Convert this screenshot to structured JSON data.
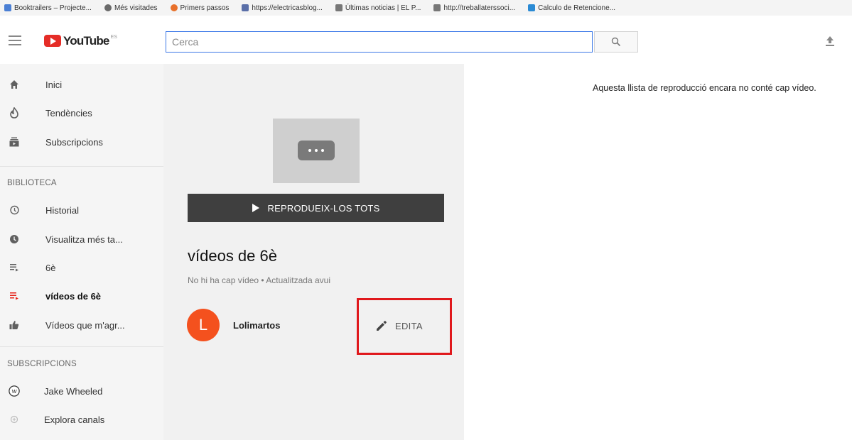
{
  "bookmarks": [
    {
      "label": "Booktrailers – Projecte...",
      "color": "#4a7fd4"
    },
    {
      "label": "Més visitades",
      "color": "#6a6a6a"
    },
    {
      "label": "Primers passos",
      "color": "#e8702a"
    },
    {
      "label": "https://electricasblog...",
      "color": "#5a6fa8"
    },
    {
      "label": "Últimas noticias | EL P...",
      "color": "#777777"
    },
    {
      "label": "http://treballaterssoci...",
      "color": "#777777"
    },
    {
      "label": "Calculo de Retencione...",
      "color": "#2a8ad4"
    }
  ],
  "masthead": {
    "logo_text": "YouTube",
    "country_code": "ES",
    "search_placeholder": "Cerca"
  },
  "sidebar": {
    "top_items": [
      {
        "label": "Inici",
        "icon": "home-icon"
      },
      {
        "label": "Tendències",
        "icon": "trending-icon"
      },
      {
        "label": "Subscripcions",
        "icon": "subscriptions-icon"
      }
    ],
    "library_title": "BIBLIOTECA",
    "library_items": [
      {
        "label": "Historial",
        "icon": "history-icon"
      },
      {
        "label": "Visualitza més ta...",
        "icon": "watch-later-icon"
      },
      {
        "label": "6è",
        "icon": "playlist-icon"
      },
      {
        "label": "vídeos de 6è",
        "icon": "playlist-icon",
        "active": true
      },
      {
        "label": "Vídeos que m'agr...",
        "icon": "thumbs-up-icon"
      }
    ],
    "subscriptions_title": "SUBSCRIPCIONS",
    "subscription_items": [
      {
        "label": "Jake Wheeled",
        "icon": "channel-avatar-icon"
      },
      {
        "label": "Explora canals",
        "icon": "add-circle-icon"
      }
    ]
  },
  "playlist": {
    "play_all_label": "REPRODUEIX-LOS TOTS",
    "title": "vídeos de 6è",
    "meta": "No hi ha cap vídeo • Actualitzada avui",
    "owner_initial": "L",
    "owner_name": "Lolimartos",
    "edit_label": "EDITA",
    "accent_color": "#f4511e",
    "highlight_color": "#e0181c"
  },
  "main": {
    "empty_message": "Aquesta llista de reproducció encara no conté cap vídeo."
  }
}
